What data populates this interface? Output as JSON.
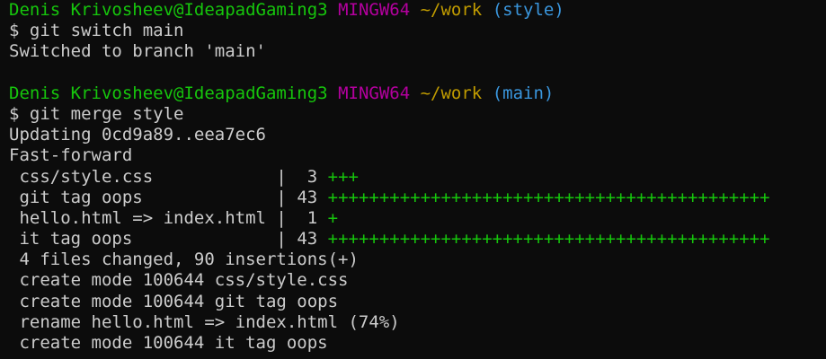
{
  "colors": {
    "background": "#0c0c0c",
    "text": "#cccccc",
    "user_host": "#16c60c",
    "system": "#b4009e",
    "directory": "#c19c00",
    "branch": "#3a96dd",
    "insertions": "#16c60c"
  },
  "prompts": [
    {
      "user_host": "Denis Krivosheev@IdeapadGaming3",
      "system": "MINGW64",
      "directory": "~/work",
      "branch": "(style)"
    },
    {
      "user_host": "Denis Krivosheev@IdeapadGaming3",
      "system": "MINGW64",
      "directory": "~/work",
      "branch": "(main)"
    }
  ],
  "commands": [
    "$ git switch main",
    "$ git merge style"
  ],
  "switch_output": "Switched to branch 'main'",
  "merge": {
    "updating": "Updating 0cd9a89..eea7ec6",
    "mode": "Fast-forward",
    "diffstat": [
      {
        "file": " css/style.css            ",
        "sep": "|",
        "count": "  3",
        "bar": "+++"
      },
      {
        "file": " git tag oops             ",
        "sep": "|",
        "count": " 43",
        "bar": "+++++++++++++++++++++++++++++++++++++++++++"
      },
      {
        "file": " hello.html => index.html ",
        "sep": "|",
        "count": "  1",
        "bar": "+"
      },
      {
        "file": " it tag oops              ",
        "sep": "|",
        "count": " 43",
        "bar": "+++++++++++++++++++++++++++++++++++++++++++"
      }
    ],
    "summary": " 4 files changed, 90 insertions(+)",
    "modes": [
      " create mode 100644 css/style.css",
      " create mode 100644 git tag oops",
      " rename hello.html => index.html (74%)",
      " create mode 100644 it tag oops"
    ]
  }
}
